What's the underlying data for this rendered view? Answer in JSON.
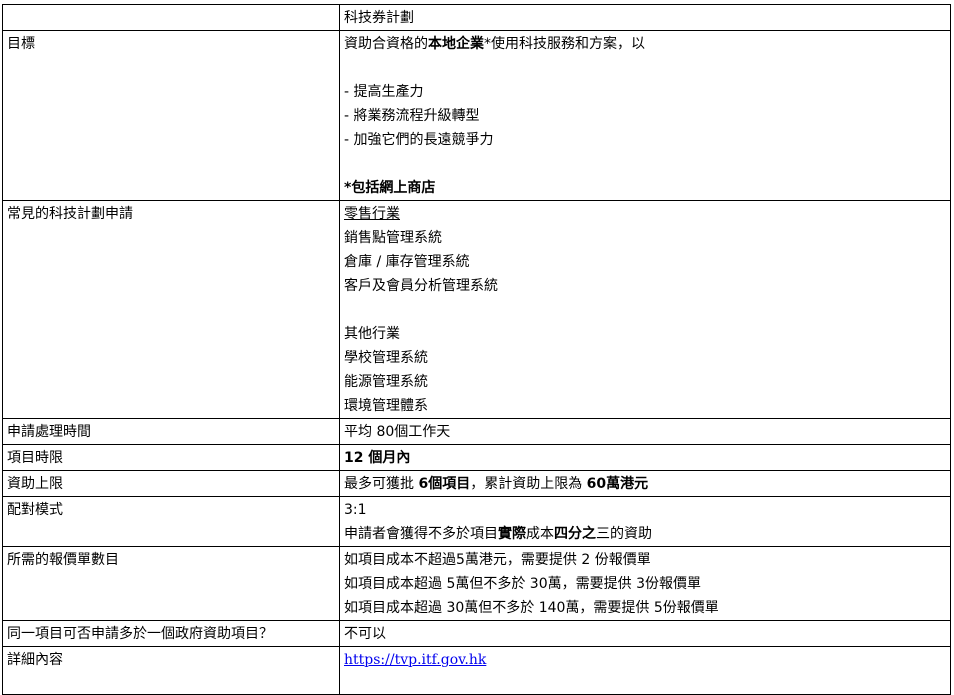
{
  "header": {
    "label": "",
    "value": "科技券計劃"
  },
  "rows": {
    "goal": {
      "label": "目標",
      "intro_pre": "資助合資格的",
      "intro_bold": "本地企業",
      "intro_post": "*使用科技服務和方案，以",
      "items": [
        "- 提高生產力",
        "- 將業務流程升級轉型",
        "- 加強它們的長遠競爭力"
      ],
      "note": "*包括網上商店"
    },
    "common": {
      "label": "常見的科技計劃申請",
      "retail_title": "零售行業",
      "retail_items": [
        "銷售點管理系統",
        "倉庫 / 庫存管理系統",
        "客戶及會員分析管理系統"
      ],
      "other_title": "其他行業",
      "other_items": [
        "學校管理系統",
        "能源管理系統",
        "環境管理體系"
      ]
    },
    "processing": {
      "label": "申請處理時間",
      "value": "平均 80個工作天"
    },
    "duration": {
      "label": "項目時限",
      "value": "12 個月內"
    },
    "cap": {
      "label": "資助上限",
      "pre": "最多可獲批 ",
      "bold1": "6個項目",
      "mid": "，累計資助上限為 ",
      "bold2": "60萬港元"
    },
    "matching": {
      "label": "配對模式",
      "ratio": "3:1",
      "desc_pre": "申請者會獲得不多於項目",
      "desc_bold1": "實際",
      "desc_mid": "成本",
      "desc_bold2": "四分之",
      "desc_post": "三的資助"
    },
    "quotes": {
      "label": "所需的報價單數目",
      "items": [
        "如項目成本不超過5萬港元，需要提供 2 份報價單",
        "如項目成本超過 5萬但不多於 30萬，需要提供 3份報價單",
        "如項目成本超過 30萬但不多於 140萬，需要提供 5份報價單"
      ]
    },
    "multiple": {
      "label": "同一項目可否申請多於一個政府資助項目？",
      "value": "不可以"
    },
    "details": {
      "label": "詳細內容",
      "link": "https://tvp.itf.gov.hk"
    }
  }
}
